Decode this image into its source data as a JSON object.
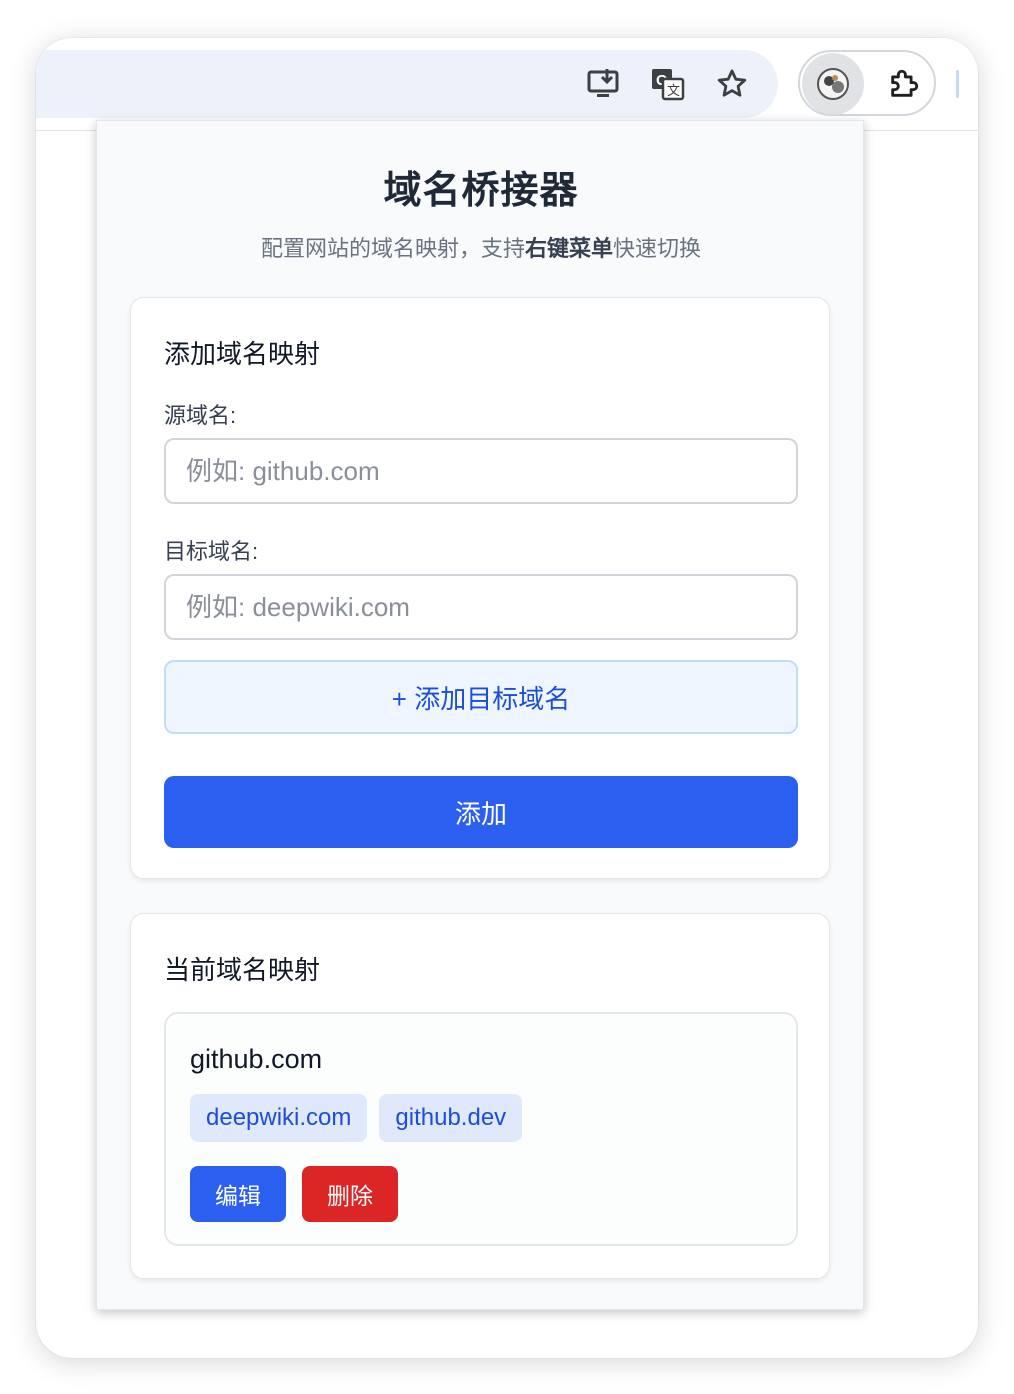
{
  "browser": {
    "toolbar_icons": [
      "install-app-icon",
      "translate-icon",
      "bookmark-star-icon"
    ],
    "extension_icon": "extension-avatar-icon",
    "extensions_menu_icon": "puzzle-icon"
  },
  "popup": {
    "title": "域名桥接器",
    "subtitle_pre": "配置网站的域名映射，支持",
    "subtitle_bold": "右键菜单",
    "subtitle_post": "快速切换"
  },
  "add_form": {
    "heading": "添加域名映射",
    "source_label": "源域名:",
    "source_placeholder": "例如: github.com",
    "source_value": "",
    "target_label": "目标域名:",
    "target_placeholder": "例如: deepwiki.com",
    "target_value": "",
    "add_target_label": "+ 添加目标域名",
    "submit_label": "添加"
  },
  "mappings": {
    "heading": "当前域名映射",
    "items": [
      {
        "source": "github.com",
        "targets": [
          "deepwiki.com",
          "github.dev"
        ],
        "edit_label": "编辑",
        "delete_label": "删除"
      }
    ]
  },
  "colors": {
    "primary": "#2b5ff0",
    "danger": "#dc2626",
    "chip_bg": "#e0e9fb",
    "chip_text": "#1d4ed8"
  }
}
